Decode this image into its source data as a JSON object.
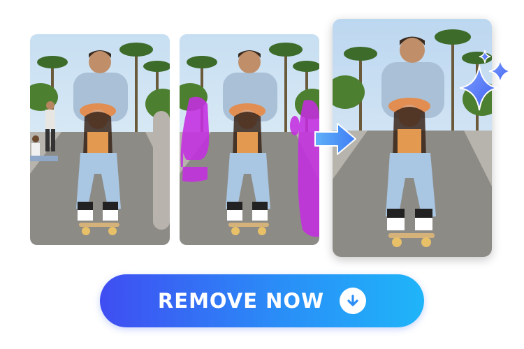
{
  "panels": [
    {
      "id": "original",
      "name": "original-photo",
      "highlight": false,
      "extras": true
    },
    {
      "id": "masked",
      "name": "masked-photo",
      "highlight": true,
      "extras": true
    },
    {
      "id": "result",
      "name": "result-photo",
      "highlight": false,
      "extras": false
    }
  ],
  "arrow_icon": "arrow-right-icon",
  "sparkle_icon": "sparkle-icon",
  "cta": {
    "label": "REMOVE NOW",
    "icon": "download-arrow-icon"
  },
  "colors": {
    "mask": "#c42ee0",
    "accent_start": "#3f4df2",
    "accent_end": "#1fb5f9",
    "arrow": "#4a9cf6"
  }
}
